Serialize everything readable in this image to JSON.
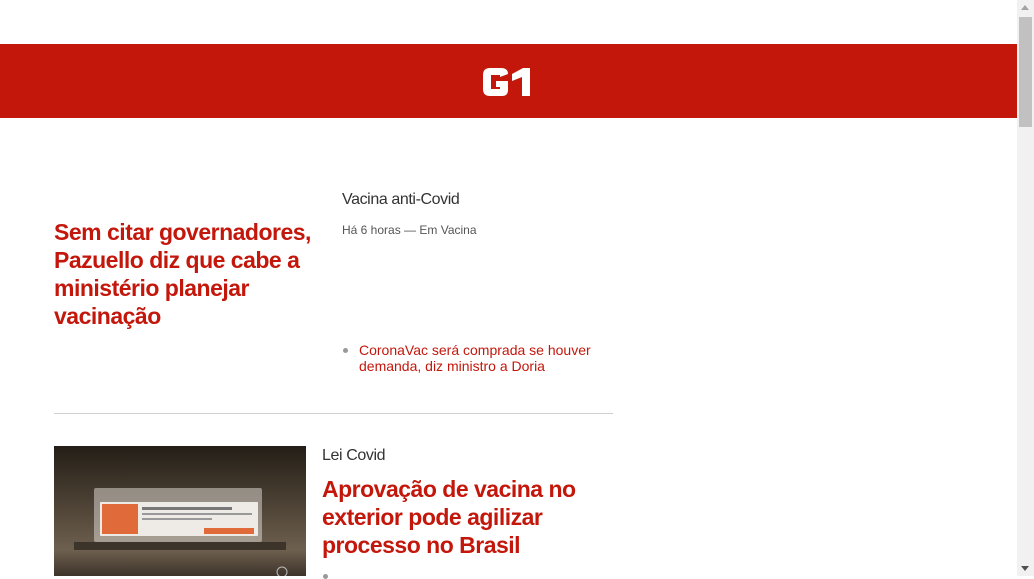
{
  "header": {
    "logo_text": "G1",
    "brand_color": "#c4170c"
  },
  "feed": {
    "items": [
      {
        "headline": "Sem citar governadores, Pazuello diz que cabe a ministério planejar vacinação",
        "section": "Vacina anti-Covid",
        "meta": "Há 6 horas — Em Vacina",
        "related": [
          {
            "label": "CoronaVac será comprada se houver demanda, diz ministro a Doria"
          }
        ]
      },
      {
        "image_icon": "vaccine-box-photo",
        "section": "Lei Covid",
        "headline": "Aprovação de vacina no exterior pode agilizar processo no Brasil"
      }
    ]
  },
  "colors": {
    "headline": "#c4170c",
    "section": "#333333",
    "meta": "#555555",
    "divider": "#d0d0d0"
  }
}
